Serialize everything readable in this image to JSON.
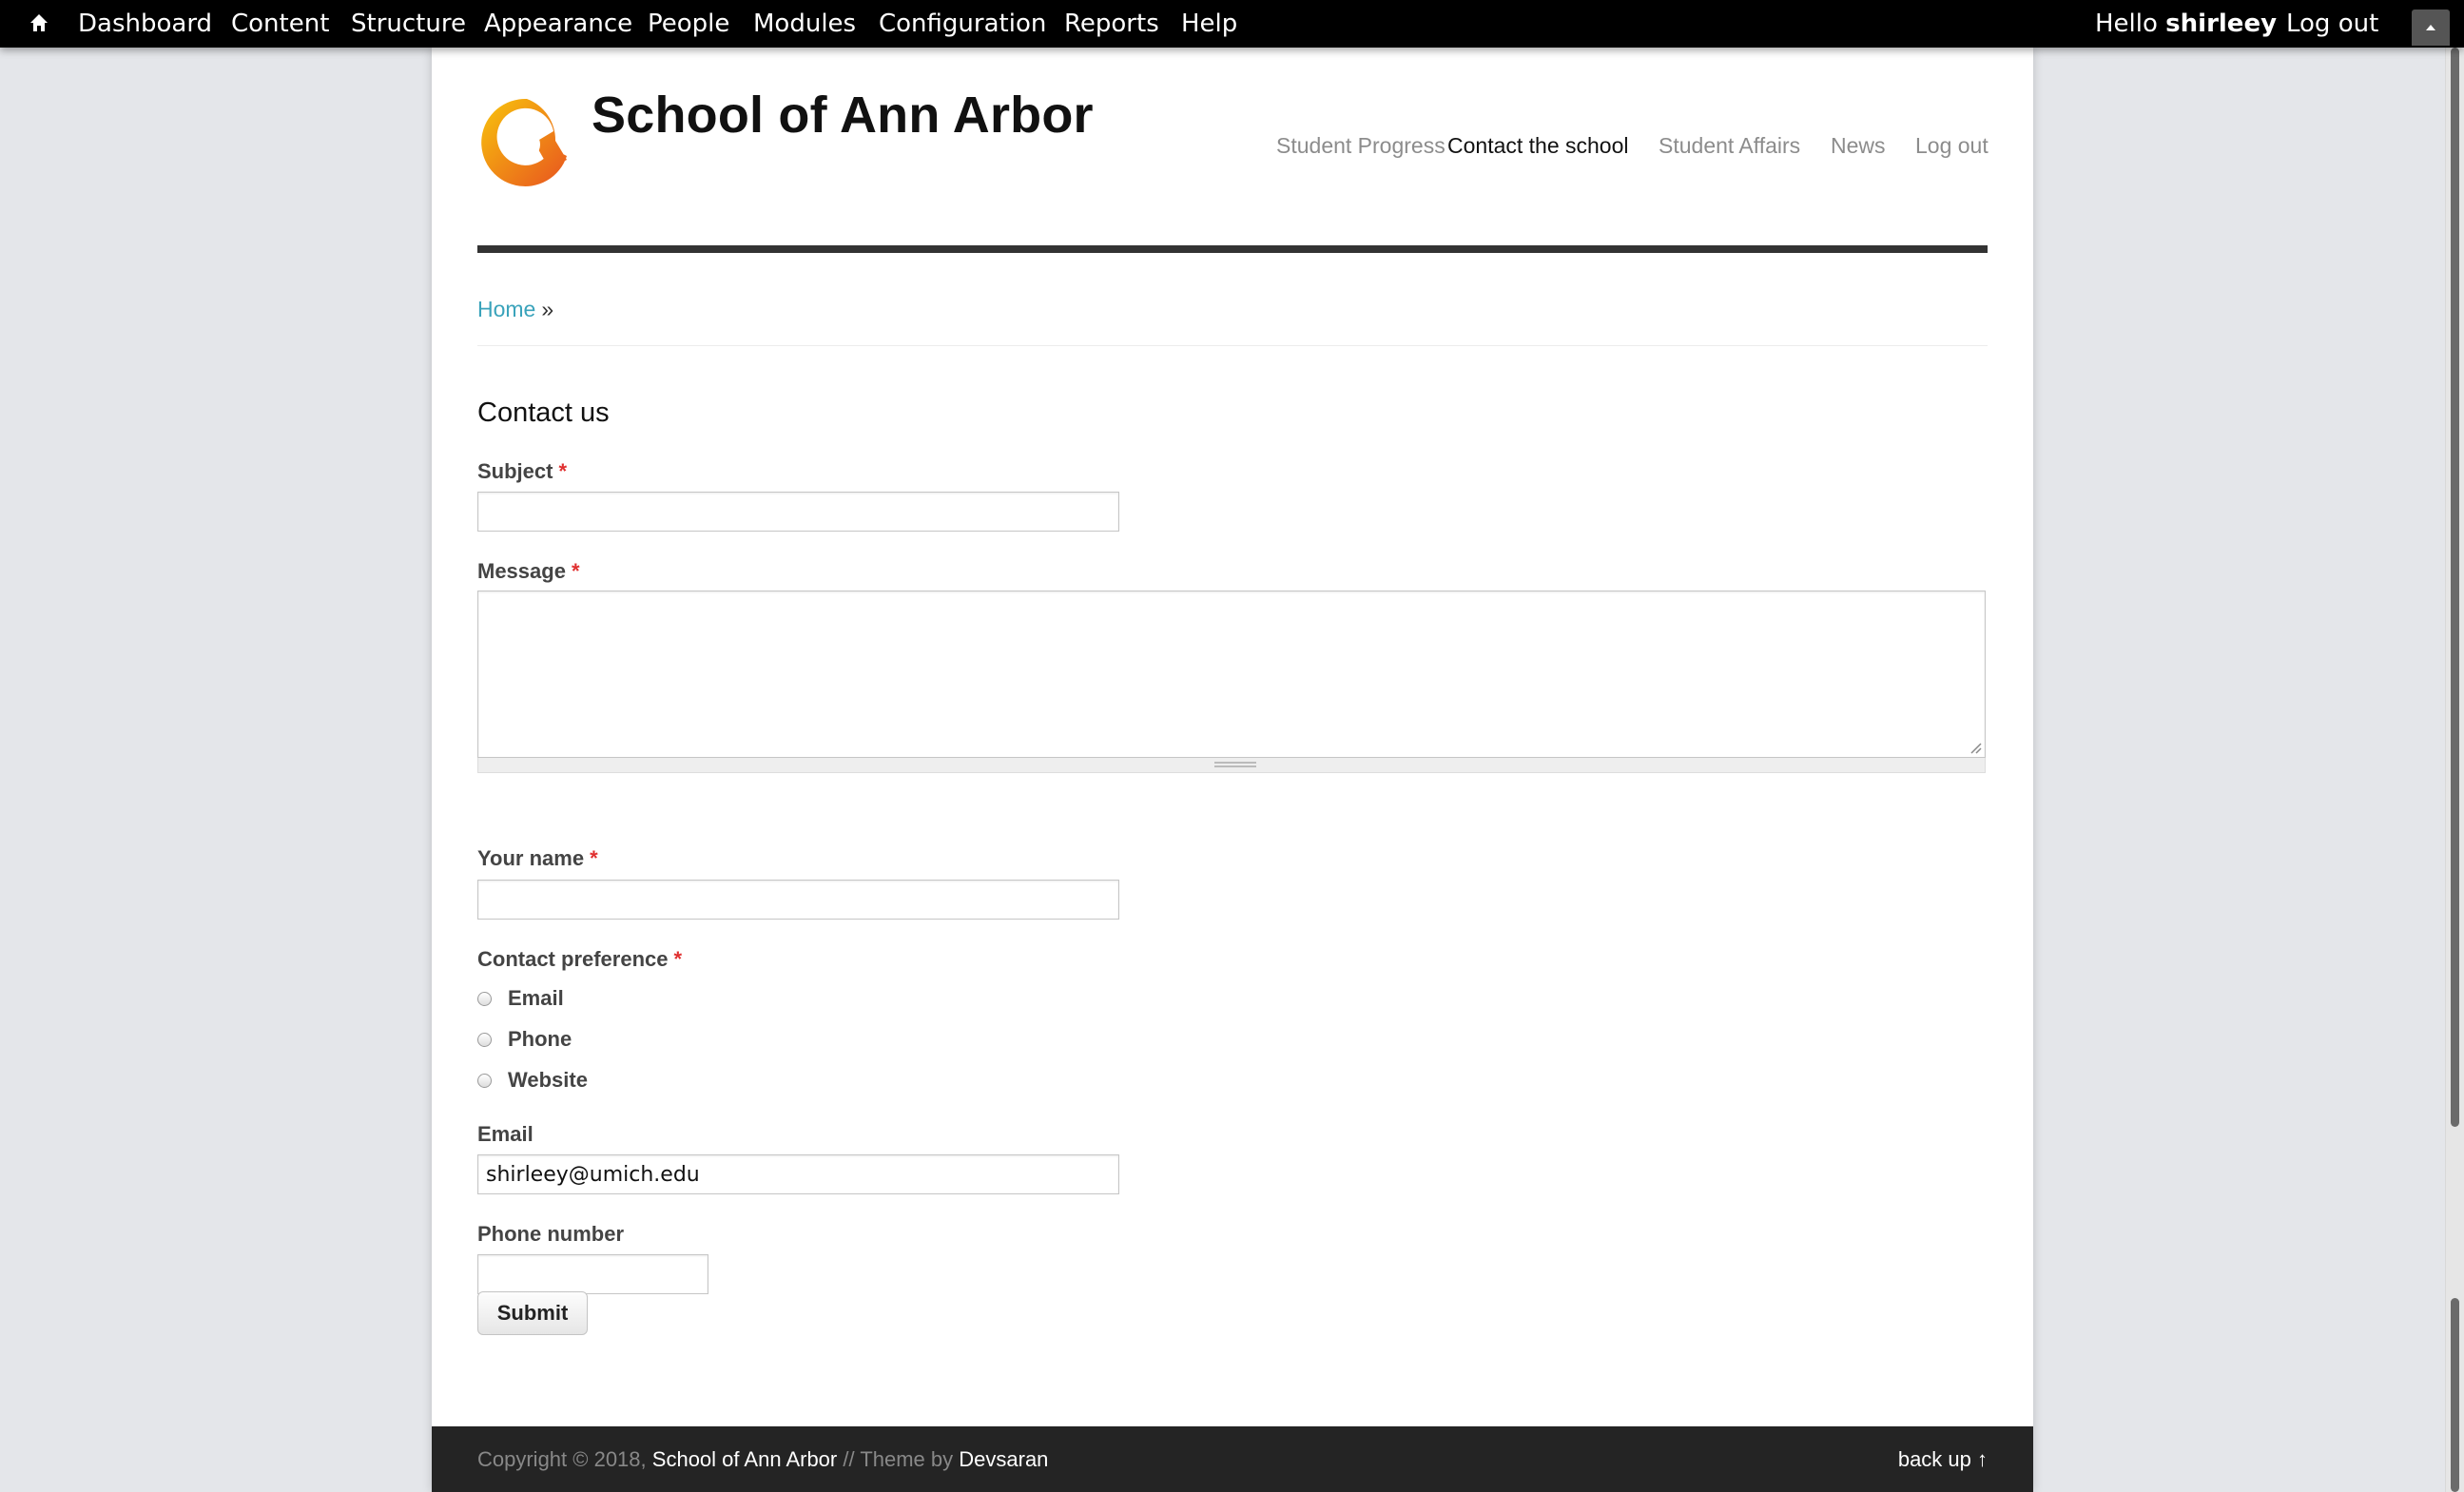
{
  "toolbar": {
    "home_icon": "home-icon",
    "items": [
      "Dashboard",
      "Content",
      "Structure",
      "Appearance",
      "People",
      "Modules",
      "Configuration",
      "Reports",
      "Help"
    ],
    "hello": "Hello",
    "username": "shirleey",
    "logout": "Log out"
  },
  "site": {
    "name": "School of Ann Arbor",
    "logo_icon": "drupal-logo-icon",
    "nav": [
      "Student Progress",
      "Contact the school",
      "Student Affairs",
      "News",
      "Log out"
    ],
    "active_nav": "Contact the school"
  },
  "breadcrumb": {
    "home": "Home",
    "separator": "»"
  },
  "page": {
    "title": "Contact us"
  },
  "form": {
    "required_marker": "*",
    "subject_label": "Subject",
    "subject_value": "",
    "message_label": "Message",
    "message_value": "",
    "name_label": "Your name",
    "name_value": "",
    "preference_label": "Contact preference",
    "preference_options": [
      "Email",
      "Phone",
      "Website"
    ],
    "email_label": "Email",
    "email_value": "shirleey@umich.edu",
    "phone_label": "Phone number",
    "phone_value": "",
    "submit_label": "Submit"
  },
  "footer": {
    "copyright_prefix": "Copyright © 2018,",
    "site_link": "School of Ann Arbor",
    "theme_text": "// Theme by",
    "theme_link": "Devsaran",
    "back_up": "back up ↑"
  },
  "colors": {
    "toolbar_bg": "#000000",
    "link_teal": "#3aa3bb",
    "required_red": "#e03030",
    "footer_bg": "#242424",
    "header_rule": "#333333"
  }
}
